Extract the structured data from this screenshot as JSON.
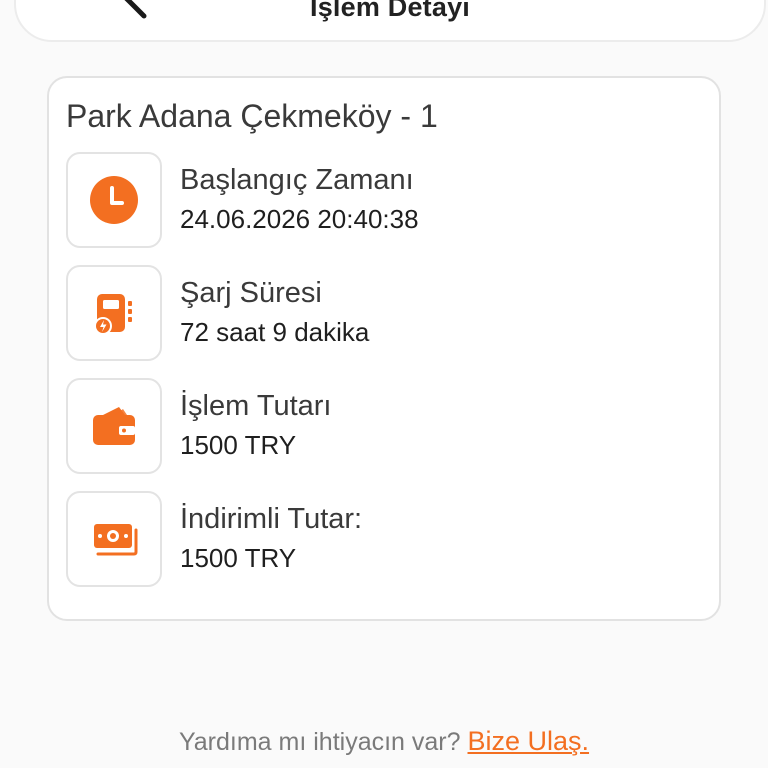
{
  "header": {
    "title": "İşlem Detayı"
  },
  "station": {
    "name": "Park Adana Çekmeköy - 1"
  },
  "details": [
    {
      "icon": "clock-icon",
      "label": "Başlangıç Zamanı",
      "value": "24.06.2026 20:40:38"
    },
    {
      "icon": "charging-device-icon",
      "label": "Şarj Süresi",
      "value": "72 saat 9 dakika"
    },
    {
      "icon": "wallet-icon",
      "label": "İşlem Tutarı",
      "value": "1500 TRY"
    },
    {
      "icon": "banknotes-icon",
      "label": "İndirimli Tutar:",
      "value": "1500 TRY"
    }
  ],
  "footer": {
    "question": "Yardıma mı ihtiyacın var?",
    "link": "Bize Ulaş."
  },
  "colors": {
    "accent": "#f36f21",
    "background": "#fafafa",
    "card": "#ffffff"
  }
}
